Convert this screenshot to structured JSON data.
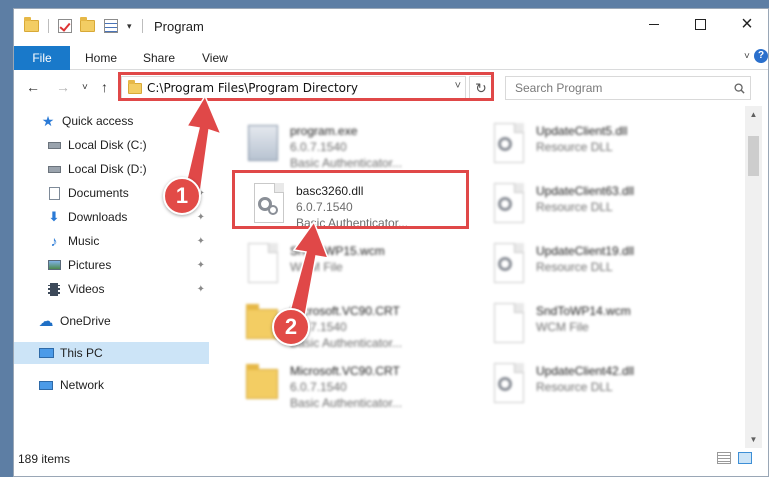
{
  "window": {
    "title": "Program",
    "controls": {
      "minimize_icon": "minimize-icon",
      "maximize_icon": "maximize-icon",
      "close_icon": "×"
    }
  },
  "ribbon": {
    "tabs": [
      "File",
      "Home",
      "Share",
      "View"
    ],
    "expand_icon": "˅",
    "help_icon": "?"
  },
  "navigation": {
    "back_icon": "←",
    "forward_icon": "→",
    "recent_icon": "˅",
    "up_icon": "↑",
    "address": "C:\\Program Files\\Program Directory",
    "address_dropdown_icon": "˅",
    "refresh_icon": "↻",
    "search_placeholder": "Search Program"
  },
  "sidebar": {
    "items": [
      {
        "label": "Quick access",
        "icon": "star-icon",
        "pinned": false
      },
      {
        "label": "Local Disk (C:)",
        "icon": "drive-icon",
        "pinned": false
      },
      {
        "label": "Local Disk (D:)",
        "icon": "drive-icon",
        "pinned": false
      },
      {
        "label": "Documents",
        "icon": "documents-icon",
        "pinned": true
      },
      {
        "label": "Downloads",
        "icon": "download-icon",
        "pinned": true
      },
      {
        "label": "Music",
        "icon": "music-icon",
        "pinned": true
      },
      {
        "label": "Pictures",
        "icon": "pictures-icon",
        "pinned": true
      },
      {
        "label": "Videos",
        "icon": "videos-icon",
        "pinned": true
      },
      {
        "label": "OneDrive",
        "icon": "cloud-icon",
        "pinned": false
      },
      {
        "label": "This PC",
        "icon": "computer-icon",
        "pinned": false,
        "selected": true
      },
      {
        "label": "Network",
        "icon": "network-icon",
        "pinned": false
      }
    ],
    "pin_icon": "📌"
  },
  "files": {
    "left": [
      {
        "name": "program.exe",
        "meta1": "6.0.7.1540",
        "meta2": "Basic Authenticator...",
        "icon": "exe-icon"
      },
      {
        "name": "basc3260.dll",
        "meta1": "6.0.7.1540",
        "meta2": "Basic Authenticator...",
        "icon": "dll-icon",
        "highlighted": true
      },
      {
        "name": "SndToWP15.wcm",
        "meta1": "WCM File",
        "meta2": "",
        "icon": "file-icon"
      },
      {
        "name": "Microsoft.VC90.CRT",
        "meta1": "6.0.7.1540",
        "meta2": "Basic Authenticator...",
        "icon": "folder-icon"
      },
      {
        "name": "Microsoft.VC90.CRT",
        "meta1": "6.0.7.1540",
        "meta2": "Basic Authenticator...",
        "icon": "folder-icon"
      }
    ],
    "right": [
      {
        "name": "UpdateClient5.dll",
        "meta1": "Resource DLL",
        "icon": "dll-icon"
      },
      {
        "name": "UpdateClient63.dll",
        "meta1": "Resource DLL",
        "icon": "dll-icon"
      },
      {
        "name": "UpdateClient19.dll",
        "meta1": "Resource DLL",
        "icon": "dll-icon"
      },
      {
        "name": "SndToWP14.wcm",
        "meta1": "WCM File",
        "icon": "file-icon"
      },
      {
        "name": "UpdateClient42.dll",
        "meta1": "Resource DLL",
        "icon": "dll-icon"
      }
    ]
  },
  "status": {
    "item_count": "189 items"
  },
  "annotations": {
    "step1": "1",
    "step2": "2",
    "color": "#e04848"
  }
}
